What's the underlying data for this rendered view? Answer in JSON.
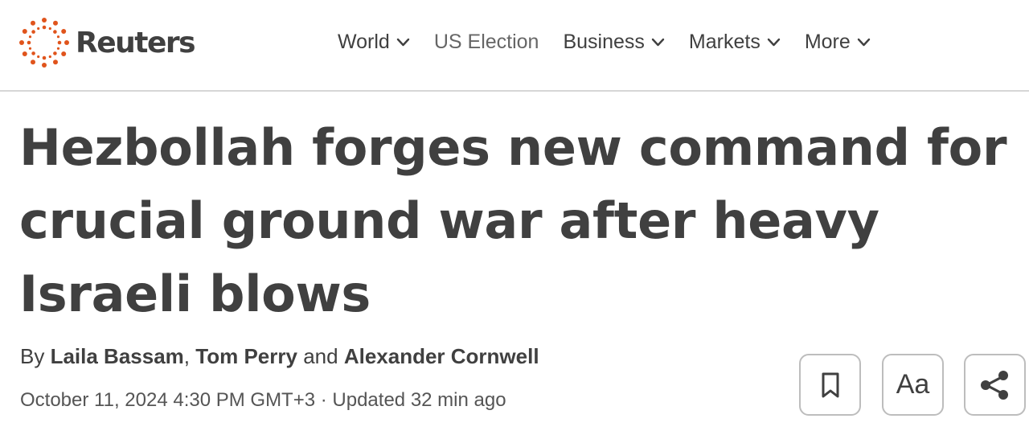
{
  "header": {
    "brand": "Reuters",
    "nav": [
      {
        "label": "World",
        "has_dropdown": true
      },
      {
        "label": "US Election",
        "has_dropdown": false
      },
      {
        "label": "Business",
        "has_dropdown": true
      },
      {
        "label": "Markets",
        "has_dropdown": true
      },
      {
        "label": "More",
        "has_dropdown": true
      }
    ]
  },
  "article": {
    "headline": "Hezbollah forges new command for crucial ground war after heavy Israeli blows",
    "byline_prefix": "By",
    "authors": [
      "Laila Bassam",
      "Tom Perry",
      "Alexander Cornwell"
    ],
    "author_separator": ",",
    "author_conjunction": "and",
    "date": "October 11, 2024 4:30 PM GMT+3 · Updated 32 min ago"
  },
  "actions": {
    "bookmark_icon": "bookmark-icon",
    "text_size_label": "Aa",
    "share_icon": "share-icon"
  },
  "colors": {
    "brand_orange": "#e0541c",
    "text": "#404040",
    "divider": "#d6d6d6",
    "button_border": "#bdbdbd"
  }
}
